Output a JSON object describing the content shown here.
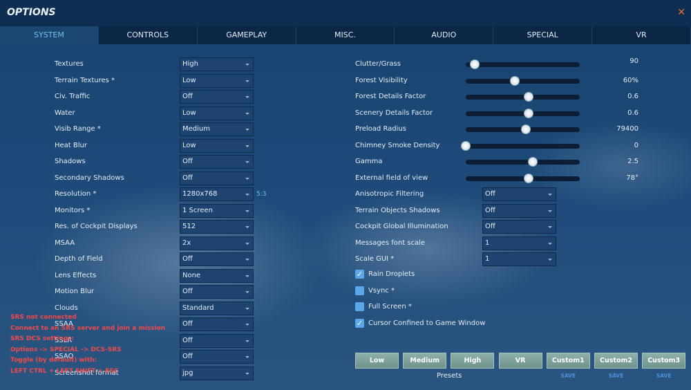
{
  "header": {
    "title": "OPTIONS",
    "close_icon": "close-x-icon"
  },
  "tabs": [
    "SYSTEM",
    "CONTROLS",
    "GAMEPLAY",
    "MISC.",
    "AUDIO",
    "SPECIAL",
    "VR"
  ],
  "active_tab": "SYSTEM",
  "left_settings": [
    {
      "label": "Textures",
      "value": "High"
    },
    {
      "label": "Terrain Textures *",
      "value": "Low"
    },
    {
      "label": "Civ. Traffic",
      "value": "Off"
    },
    {
      "label": "Water",
      "value": "Low"
    },
    {
      "label": "Visib Range *",
      "value": "Medium"
    },
    {
      "label": "Heat Blur",
      "value": "Low"
    },
    {
      "label": "Shadows",
      "value": "Off"
    },
    {
      "label": "Secondary Shadows",
      "value": "Off"
    },
    {
      "label": "Resolution *",
      "value": "1280x768"
    },
    {
      "label": "Monitors *",
      "value": "1 Screen"
    },
    {
      "label": "Res. of Cockpit Displays",
      "value": "512"
    },
    {
      "label": "MSAA",
      "value": "2x"
    },
    {
      "label": "Depth of Field",
      "value": "Off"
    },
    {
      "label": "Lens Effects",
      "value": "None"
    },
    {
      "label": "Motion Blur",
      "value": "Off"
    },
    {
      "label": "Clouds",
      "value": "Standard"
    },
    {
      "label": "SSAA",
      "value": "Off"
    },
    {
      "label": "SSLR",
      "value": "Off"
    },
    {
      "label": "SSAO",
      "value": "Off"
    },
    {
      "label": "Screenshot format",
      "value": "jpg"
    }
  ],
  "aspect_ratio": "5:3",
  "sliders": [
    {
      "label": "Clutter/Grass",
      "value": "90",
      "level": 0.08
    },
    {
      "label": "Forest Visibility",
      "value": "60%",
      "level": 0.43
    },
    {
      "label": "Forest Details Factor",
      "value": "0.6",
      "level": 0.55
    },
    {
      "label": "Scenery Details Factor",
      "value": "0.6",
      "level": 0.55
    },
    {
      "label": "Preload Radius",
      "value": "79400",
      "level": 0.53
    },
    {
      "label": "Chimney Smoke Density",
      "value": "0",
      "level": 0.0
    },
    {
      "label": "Gamma",
      "value": "2.5",
      "level": 0.59
    },
    {
      "label": "External field of view",
      "value": "78°",
      "level": 0.55
    }
  ],
  "right_selects": [
    {
      "label": "Anisotropic Filtering",
      "value": "Off"
    },
    {
      "label": "Terrain Objects Shadows",
      "value": "Off"
    },
    {
      "label": " Cockpit Global Illumination",
      "value": "Off"
    },
    {
      "label": "Messages font scale",
      "value": "1"
    },
    {
      "label": "Scale GUI *",
      "value": "1"
    }
  ],
  "checkboxes": [
    {
      "label": "Rain Droplets",
      "checked": true
    },
    {
      "label": "Vsync *",
      "checked": false
    },
    {
      "label": "Full Screen *",
      "checked": false
    },
    {
      "label": "Cursor Confined to Game Window",
      "checked": true
    }
  ],
  "presets": {
    "label": "Presets",
    "buttons": [
      "Low",
      "Medium",
      "High",
      "VR",
      "Custom1",
      "Custom2",
      "Custom3"
    ],
    "save_label": "SAVE"
  },
  "srs_overlay": [
    "SRS not connected",
    "Connect to an SRS server and join a mission",
    "SRS DCS settings:",
    "Options -> SPECIAL -> DCS-SRS",
    "Toggle (by default) with:",
    "LEFT CTRL + LEFT SHIFT + ESC"
  ],
  "colors": {
    "accent": "#6cc4e8",
    "overlay_text": "#f04a4a",
    "save_link": "#4a90d9"
  }
}
